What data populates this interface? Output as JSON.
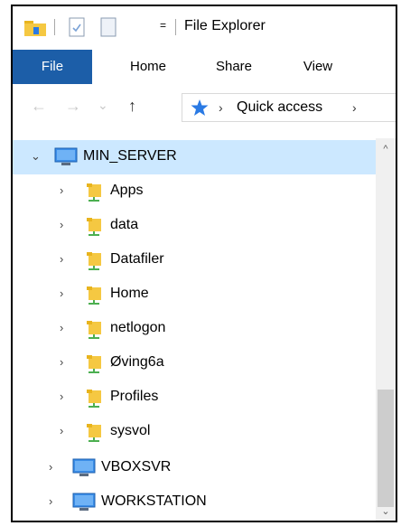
{
  "window": {
    "title": "File Explorer",
    "qat_dropdown": "="
  },
  "ribbon": {
    "tabs": [
      "File",
      "Home",
      "Share",
      "View"
    ]
  },
  "address": {
    "back": "←",
    "forward": "→",
    "recent": "⌄",
    "up": "↑",
    "sep1": "›",
    "location": "Quick access",
    "sep2": "›"
  },
  "tree": {
    "root": {
      "label": "MIN_SERVER",
      "expanded": true,
      "chevron": "⌄"
    },
    "children": [
      "Apps",
      "data",
      "Datafiler",
      "Home",
      "netlogon",
      "Øving6a",
      "Profiles",
      "sysvol"
    ],
    "siblings": [
      "VBOXSVR",
      "WORKSTATION"
    ],
    "collapsed_chevron": "›"
  },
  "scrollbar": {
    "up": "^",
    "down": "⌄",
    "thumb_position_fraction": 0.7
  },
  "colors": {
    "file_tab": "#1c5ea8",
    "selection": "#cce8ff",
    "folder": "#f5c842",
    "share_green": "#4caf50",
    "pin_blue": "#2a7ae4"
  }
}
